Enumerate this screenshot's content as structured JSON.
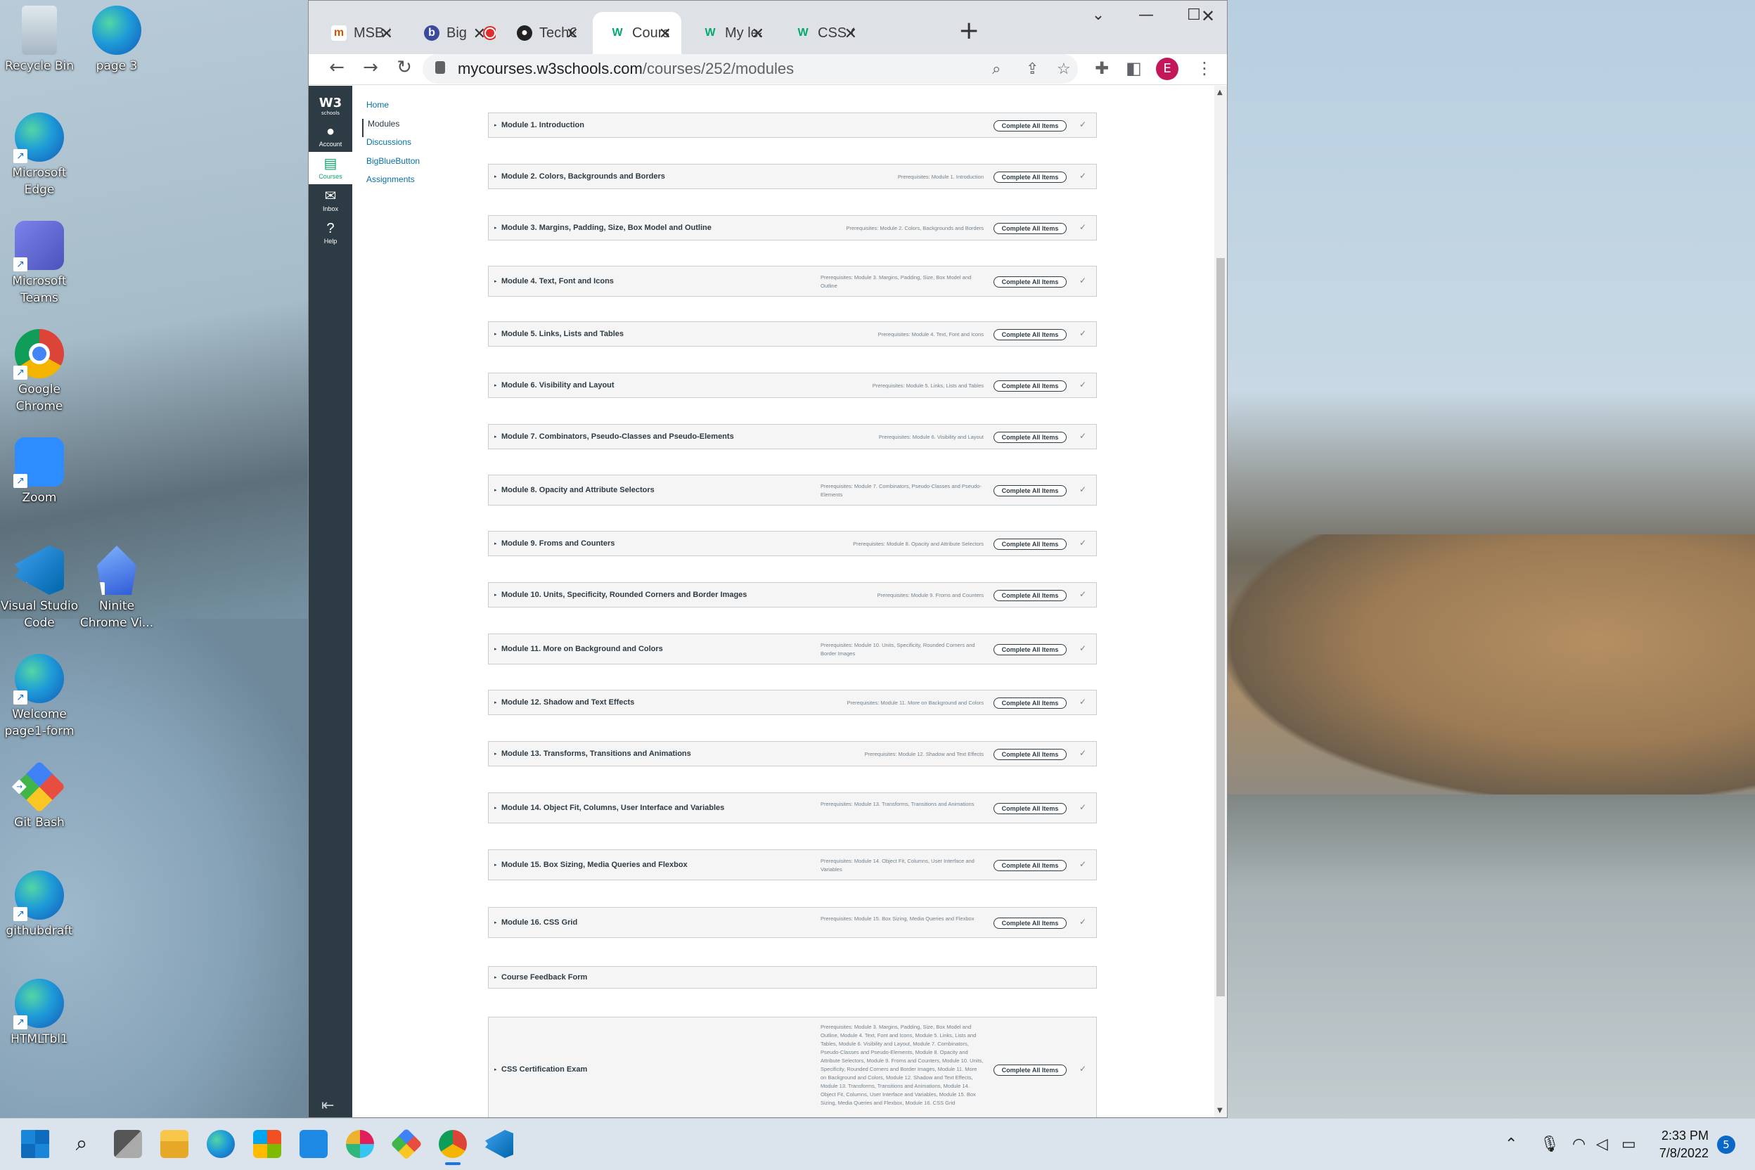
{
  "desktop": {
    "icons": [
      {
        "label": "Recycle Bin",
        "icon": "recycle-bin-icon"
      },
      {
        "label": "page 3",
        "icon": "edge-icon"
      },
      {
        "label": "Microsoft Edge",
        "icon": "edge-icon"
      },
      {
        "label": "Microsoft Teams",
        "icon": "teams-icon"
      },
      {
        "label": "Google Chrome",
        "icon": "chrome-icon"
      },
      {
        "label": "Zoom",
        "icon": "zoom-icon"
      },
      {
        "label": "Visual Studio Code",
        "icon": "vscode-icon"
      },
      {
        "label": "Ninite Chrome Vi...",
        "icon": "ninite-icon"
      },
      {
        "label": "Welcome page1-form",
        "icon": "edge-icon"
      },
      {
        "label": "Git Bash",
        "icon": "git-icon"
      },
      {
        "label": "githubdraft",
        "icon": "edge-icon"
      },
      {
        "label": "HTMLTbl1",
        "icon": "edge-icon"
      }
    ]
  },
  "browser": {
    "tabs": [
      {
        "label": "MSB-F",
        "favicon": "m"
      },
      {
        "label": "Big",
        "favicon": "b"
      },
      {
        "label": "TechGr",
        "favicon": "github"
      },
      {
        "label": "Course",
        "favicon": "w3"
      },
      {
        "label": "My lea",
        "favicon": "w3"
      },
      {
        "label": "CSS Ce",
        "favicon": "w3"
      }
    ],
    "new_tab": "+",
    "url_host": "mycourses.w3schools.com",
    "url_path": "/courses/252/modules",
    "profile_initial": "E"
  },
  "lms": {
    "logo": "W3",
    "logo_sub": "schools",
    "rail": [
      {
        "label": "Account",
        "glyph": "●"
      },
      {
        "label": "Courses",
        "glyph": "▤"
      },
      {
        "label": "Inbox",
        "glyph": "✉"
      },
      {
        "label": "Help",
        "glyph": "?"
      }
    ],
    "course_nav": [
      "Home",
      "Modules",
      "Discussions",
      "BigBlueButton",
      "Assignments"
    ],
    "requirement_label": "Complete All Items",
    "modules": [
      {
        "name": "Module 1. Introduction",
        "prereq": ""
      },
      {
        "name": "Module 2. Colors, Backgrounds and Borders",
        "prereq": "Prerequisites: Module 1. Introduction"
      },
      {
        "name": "Module 3. Margins, Padding, Size, Box Model and Outline",
        "prereq": "Prerequisites: Module 2. Colors, Backgrounds and Borders"
      },
      {
        "name": "Module 4. Text, Font and Icons",
        "prereq": "Prerequisites: Module 3. Margins, Padding, Size, Box Model and Outline"
      },
      {
        "name": "Module 5. Links, Lists and Tables",
        "prereq": "Prerequisites: Module 4. Text, Font and Icons"
      },
      {
        "name": "Module 6. Visibility and Layout",
        "prereq": "Prerequisites: Module 5. Links, Lists and Tables"
      },
      {
        "name": "Module 7. Combinators, Pseudo-Classes and Pseudo-Elements",
        "prereq": "Prerequisites: Module 6. Visibility and Layout"
      },
      {
        "name": "Module 8. Opacity and Attribute Selectors",
        "prereq": "Prerequisites: Module 7. Combinators, Pseudo-Classes and Pseudo-Elements"
      },
      {
        "name": "Module 9. Froms and Counters",
        "prereq": "Prerequisites: Module 8. Opacity and Attribute Selectors"
      },
      {
        "name": "Module 10. Units, Specificity, Rounded Corners and Border Images",
        "prereq": "Prerequisites: Module 9. Froms and Counters"
      },
      {
        "name": "Module 11. More on Background and Colors",
        "prereq": "Prerequisites: Module 10. Units, Specificity, Rounded Corners and Border Images"
      },
      {
        "name": "Module 12. Shadow and Text Effects",
        "prereq": "Prerequisites: Module 11. More on Background and Colors"
      },
      {
        "name": "Module 13. Transforms, Transitions and Animations",
        "prereq": "Prerequisites: Module 12. Shadow and Text Effects"
      },
      {
        "name": "Module 14. Object Fit, Columns, User Interface and Variables",
        "prereq": "Prerequisites: Module 13. Transforms, Transitions and Animations"
      },
      {
        "name": "Module 15. Box Sizing, Media Queries and Flexbox",
        "prereq": "Prerequisites: Module 14. Object Fit, Columns, User Interface and Variables"
      },
      {
        "name": "Module 16. CSS Grid",
        "prereq": "Prerequisites: Module 15. Box Sizing, Media Queries and Flexbox"
      },
      {
        "name": "Course Feedback Form",
        "prereq": ""
      },
      {
        "name": "CSS Certification Exam",
        "prereq": "Prerequisites: Module 3. Margins, Padding, Size, Box Model and Outline, Module 4. Text, Font and Icons, Module 5. Links, Lists and Tables, Module 6. Visibility and Layout, Module 7. Combinators, Pseudo-Classes and Pseudo-Elements, Module 8. Opacity and Attribute Selectors, Module 9. Froms and Counters, Module 10. Units, Specificity, Rounded Corners and Border Images, Module 11. More on Background and Colors, Module 12. Shadow and Text Effects, Module 13. Transforms, Transitions and Animations, Module 14. Object Fit, Columns, User Interface and Variables, Module 15. Box Sizing, Media Queries and Flexbox, Module 16. CSS Grid"
      }
    ]
  },
  "taskbar": {
    "time": "2:33 PM",
    "date": "7/8/2022",
    "notifications": "5"
  },
  "colors": {
    "canvas_nav": "#2d3b45",
    "link": "#0770a3",
    "accent_green": "#12a36b",
    "profile": "#c2185b"
  }
}
